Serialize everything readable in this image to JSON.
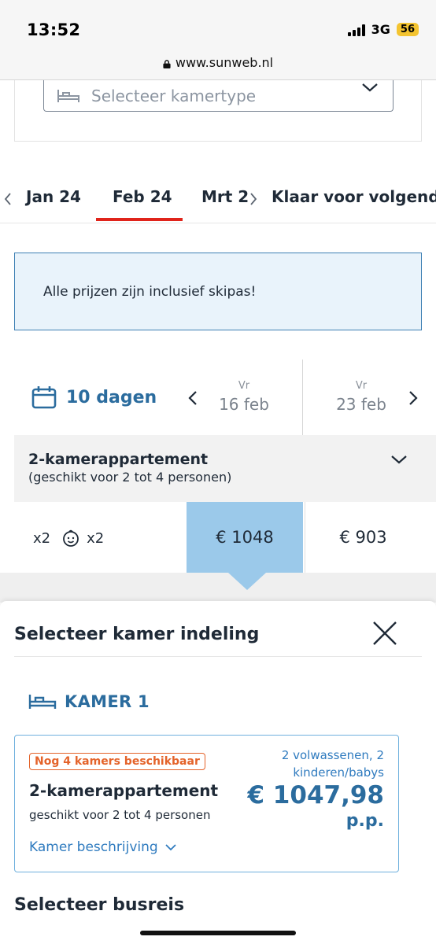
{
  "status_bar": {
    "time": "13:52",
    "network": "3G",
    "battery": "56"
  },
  "browser": {
    "url": "www.sunweb.nl"
  },
  "room_type_select": {
    "placeholder": "Selecteer kamertype"
  },
  "month_tabs": {
    "items": [
      {
        "label": "Jan 24",
        "active": false
      },
      {
        "label": "Feb 24",
        "active": true
      },
      {
        "label": "Mrt 2",
        "active": false
      },
      {
        "label": "Klaar voor volgend s",
        "active": false
      }
    ],
    "active_color": "#e0241b"
  },
  "info_box": {
    "text": "Alle prijzen zijn inclusief skipas!"
  },
  "duration": {
    "label": "10 dagen"
  },
  "dates": [
    {
      "dow": "Vr",
      "day": "16 feb"
    },
    {
      "dow": "Vr",
      "day": "23 feb"
    }
  ],
  "category": {
    "title": "2-kamerappartement",
    "subtitle": "(geschikt voor 2 tot 4 personen)"
  },
  "persons": {
    "adults": "x2",
    "children": "x2"
  },
  "prices": {
    "selected": "€ 1048",
    "other": "€ 903"
  },
  "sheet": {
    "title": "Selecteer kamer indeling",
    "room_label": "KAMER 1",
    "option": {
      "availability": "Nog 4 kamers beschikbaar",
      "title": "2-kamerappartement",
      "subtitle": "geschikt voor 2 tot 4 personen",
      "description_link": "Kamer beschrijving",
      "persons_line1": "2 volwassenen, 2",
      "persons_line2": "kinderen/babys",
      "price": "€ 1047,98",
      "price_unit": "p.p."
    },
    "bus_title": "Selecteer busreis"
  },
  "colors": {
    "brand_blue": "#2b6c9e",
    "link_blue": "#2f7bbf",
    "selected_cell": "#9bc9ea",
    "badge_orange": "#e4632a"
  }
}
